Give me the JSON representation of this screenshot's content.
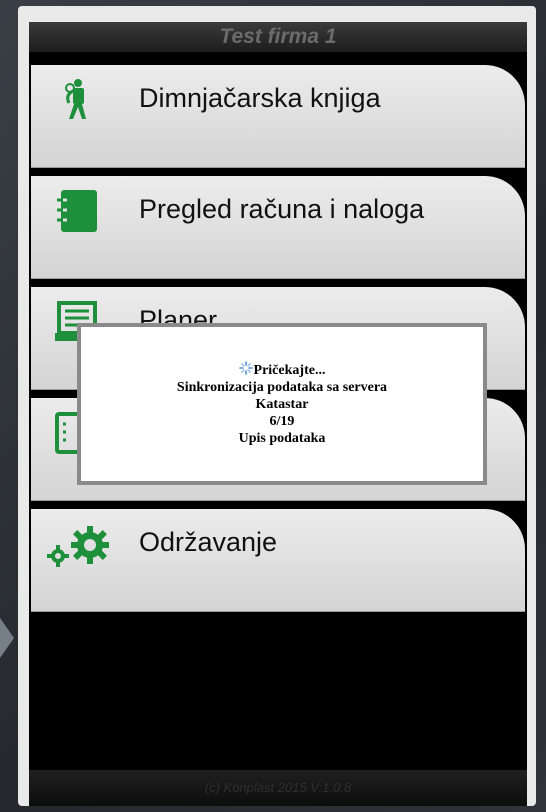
{
  "header": {
    "title": "Test firma 1"
  },
  "menu": {
    "items": [
      {
        "label": "Dimnjačarska knjiga",
        "icon": "chimney-sweep-icon"
      },
      {
        "label": "Pregled računa i naloga",
        "icon": "notebook-icon"
      },
      {
        "label": "Planer",
        "icon": "planner-tray-icon"
      },
      {
        "label": "",
        "icon": "list-icon"
      },
      {
        "label": "Održavanje",
        "icon": "gears-icon"
      }
    ]
  },
  "dialog": {
    "waiting": "Pričekajte...",
    "message": "Sinkronizacija podataka sa servera",
    "table": "Katastar",
    "progress": "6/19",
    "step": "Upis podataka"
  },
  "footer": {
    "copyright": "(c) Konplast 2015 V:1.0.8"
  },
  "colors": {
    "accent": "#1e8f3a",
    "tile": "#e0e0e0",
    "background": "#000000"
  }
}
